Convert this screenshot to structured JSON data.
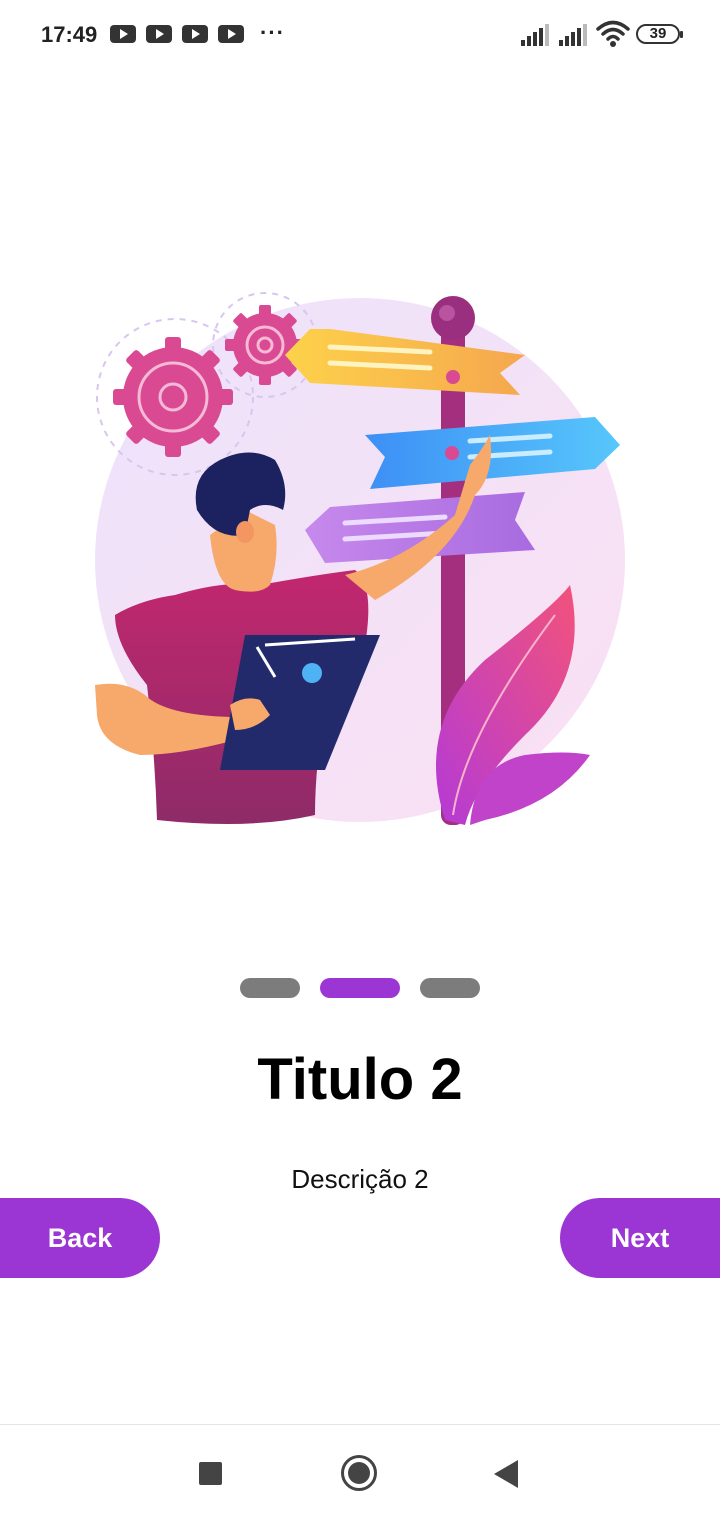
{
  "status_bar": {
    "time": "17:49",
    "notification_icons": [
      "youtube-icon",
      "youtube-icon",
      "youtube-icon",
      "youtube-icon"
    ],
    "more_indicator": "···",
    "battery_level": "39"
  },
  "illustration": {
    "description_icon": "signpost-illustration"
  },
  "pager": {
    "total": 3,
    "current": 2,
    "active_color": "#9b36d4",
    "inactive_color": "#7c7c7c"
  },
  "content": {
    "title": "Titulo 2",
    "description": "Descrição 2"
  },
  "buttons": {
    "back_label": "Back",
    "next_label": "Next",
    "color": "#9b36d4"
  },
  "nav_bar": {
    "icons": [
      "recents-square-icon",
      "home-circle-icon",
      "back-triangle-icon"
    ]
  }
}
